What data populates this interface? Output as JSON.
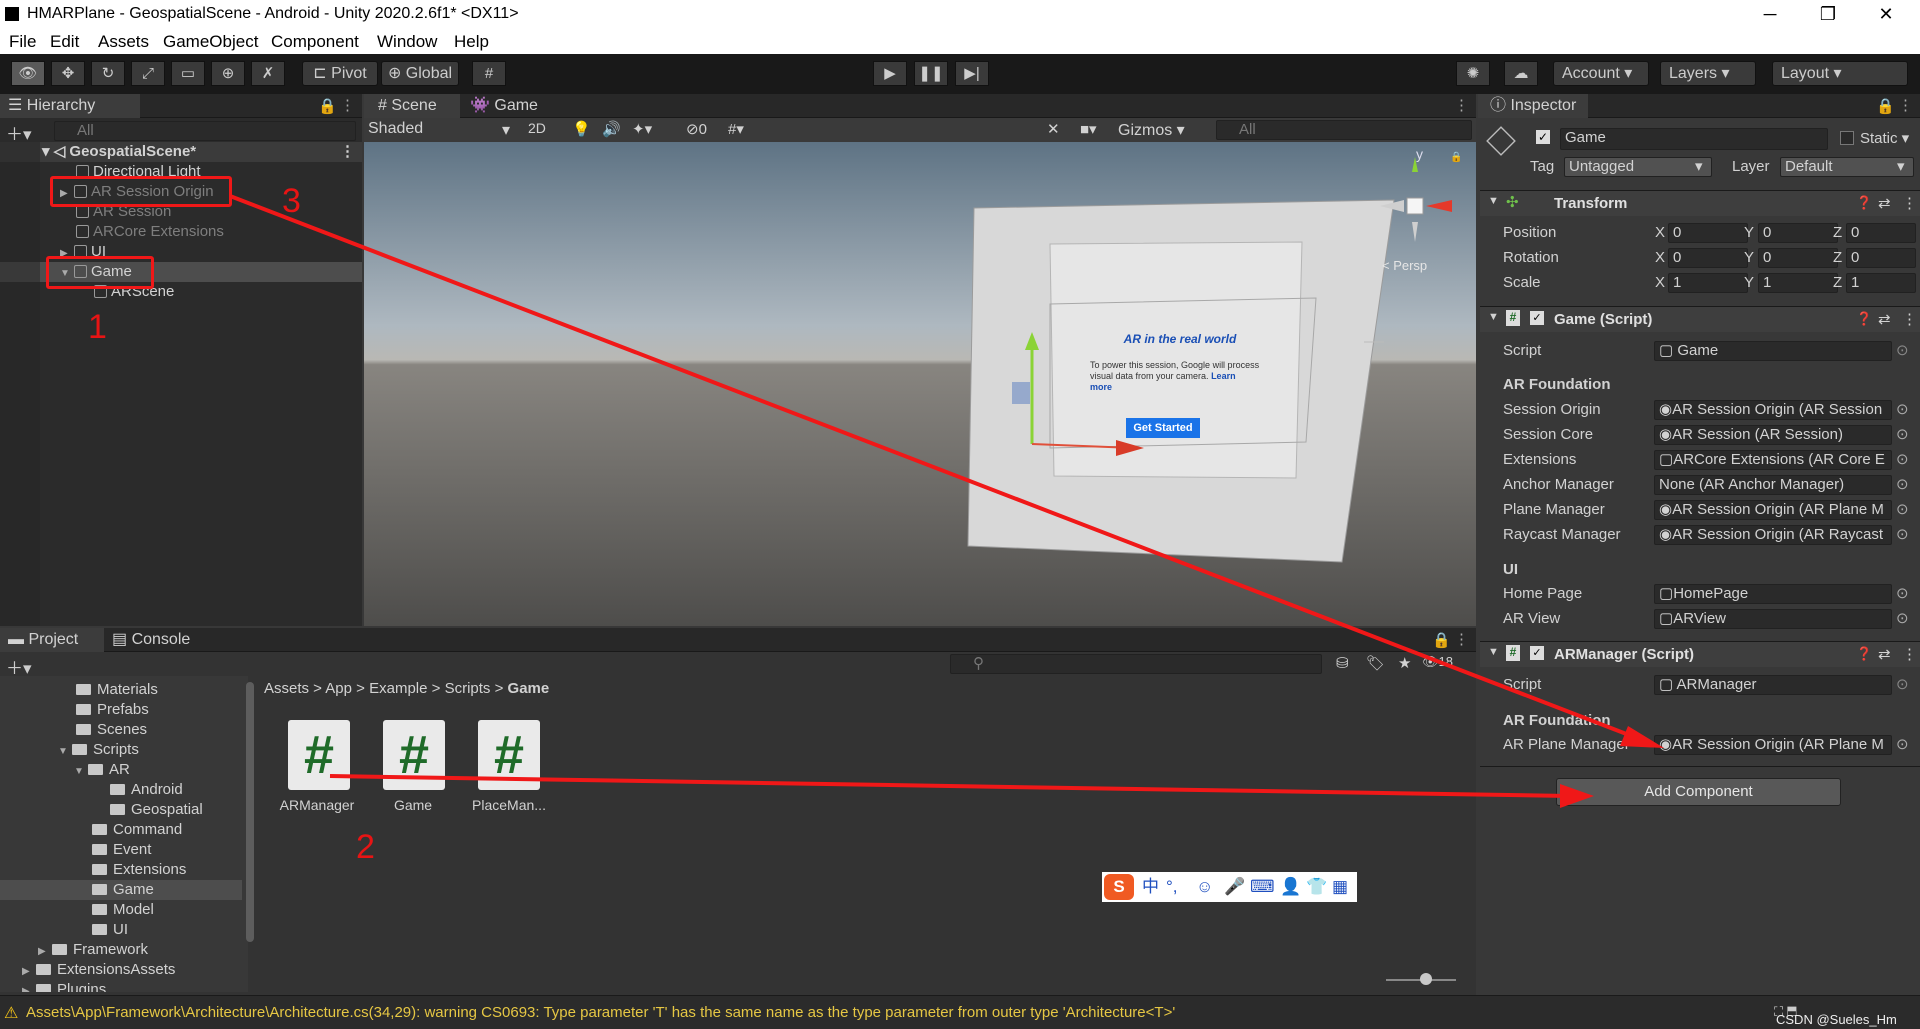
{
  "window": {
    "title": "HMARPlane - GeospatialScene - Android - Unity 2020.2.6f1* <DX11>",
    "min": "─",
    "restore": "❐",
    "close": "✕"
  },
  "menu": [
    "File",
    "Edit",
    "Assets",
    "GameObject",
    "Component",
    "Window",
    "Help"
  ],
  "toolbar": {
    "pivot": "Pivot",
    "global": "Global",
    "account": "Account",
    "layers": "Layers",
    "layout": "Layout"
  },
  "hierarchy": {
    "tab": "Hierarchy",
    "search_placeholder": "All",
    "scene": "GeospatialScene*",
    "items": [
      {
        "label": "Directional Light"
      },
      {
        "label": "AR Session Origin"
      },
      {
        "label": "AR Session"
      },
      {
        "label": "ARCore Extensions"
      },
      {
        "label": "UI"
      },
      {
        "label": "Game"
      },
      {
        "label": "ARScene"
      }
    ]
  },
  "scene_view": {
    "tab_scene": "Scene",
    "tab_game": "Game",
    "shading": "Shaded",
    "mode_2d": "2D",
    "hidden_count": "0",
    "gizmos": "Gizmos",
    "search_placeholder": "All",
    "persp": "< Persp",
    "axis_y": "y",
    "dialog_title": "AR in the real world",
    "dialog_body": "To power this session, Google will process visual data from your camera.",
    "dialog_link": "Learn more",
    "dialog_button": "Get Started"
  },
  "inspector": {
    "tab": "Inspector",
    "object_name": "Game",
    "static_label": "Static",
    "tag_label": "Tag",
    "tag_value": "Untagged",
    "layer_label": "Layer",
    "layer_value": "Default",
    "transform": {
      "title": "Transform",
      "position_label": "Position",
      "rotation_label": "Rotation",
      "scale_label": "Scale",
      "position": [
        "0",
        "0",
        "0"
      ],
      "rotation": [
        "0",
        "0",
        "0"
      ],
      "scale": [
        "1",
        "1",
        "1"
      ]
    },
    "game_script": {
      "title": "Game (Script)",
      "script_label": "Script",
      "script_value": "Game",
      "section_ar": "AR Foundation",
      "fields": [
        {
          "label": "Session Origin",
          "value": "AR Session Origin (AR Session"
        },
        {
          "label": "Session Core",
          "value": "AR Session (AR Session)"
        },
        {
          "label": "Extensions",
          "value": "ARCore Extensions (AR Core E"
        },
        {
          "label": "Anchor Manager",
          "value": "None (AR Anchor Manager)"
        },
        {
          "label": "Plane Manager",
          "value": "AR Session Origin (AR Plane M"
        },
        {
          "label": "Raycast Manager",
          "value": "AR Session Origin (AR Raycast"
        }
      ],
      "section_ui": "UI",
      "ui_fields": [
        {
          "label": "Home Page",
          "value": "HomePage"
        },
        {
          "label": "AR View",
          "value": "ARView"
        }
      ]
    },
    "armanager_script": {
      "title": "ARManager (Script)",
      "script_label": "Script",
      "script_value": "ARManager",
      "section_ar": "AR Foundation",
      "field_label": "AR Plane Manager",
      "field_value": "AR Session Origin (AR Plane M"
    },
    "add_component": "Add Component"
  },
  "project": {
    "tab_project": "Project",
    "tab_console": "Console",
    "count": "18",
    "tree": [
      {
        "label": "Materials",
        "indent": 1
      },
      {
        "label": "Prefabs",
        "indent": 1
      },
      {
        "label": "Scenes",
        "indent": 1
      },
      {
        "label": "Scripts",
        "indent": 1
      },
      {
        "label": "AR",
        "indent": 2
      },
      {
        "label": "Android",
        "indent": 3
      },
      {
        "label": "Geospatial",
        "indent": 3
      },
      {
        "label": "Command",
        "indent": 2
      },
      {
        "label": "Event",
        "indent": 2
      },
      {
        "label": "Extensions",
        "indent": 2
      },
      {
        "label": "Game",
        "indent": 2
      },
      {
        "label": "Model",
        "indent": 2
      },
      {
        "label": "UI",
        "indent": 2
      },
      {
        "label": "Framework",
        "indent": 0
      },
      {
        "label": "ExtensionsAssets",
        "indent": -1
      },
      {
        "label": "Plugins",
        "indent": -1
      }
    ],
    "breadcrumb": [
      "Assets",
      "App",
      "Example",
      "Scripts",
      "Game"
    ],
    "assets": [
      {
        "label": "ARManager"
      },
      {
        "label": "Game"
      },
      {
        "label": "PlaceMan..."
      }
    ]
  },
  "annotations": {
    "n1": "1",
    "n2": "2",
    "n3": "3"
  },
  "ime": {
    "mode": "中",
    "punct": "°,"
  },
  "status": {
    "message": "Assets\\App\\Framework\\Architecture\\Architecture.cs(34,29): warning CS0693: Type parameter 'T' has the same name as the type parameter from outer type 'Architecture<T>'",
    "watermark": "CSDN @Sueles_Hm"
  },
  "colors": {
    "accent_red": "#f01818",
    "selection": "#4d4d4d",
    "panel": "#2b2b2b",
    "script_green": "#1f6b29",
    "dialog_button": "#1a73e8"
  }
}
